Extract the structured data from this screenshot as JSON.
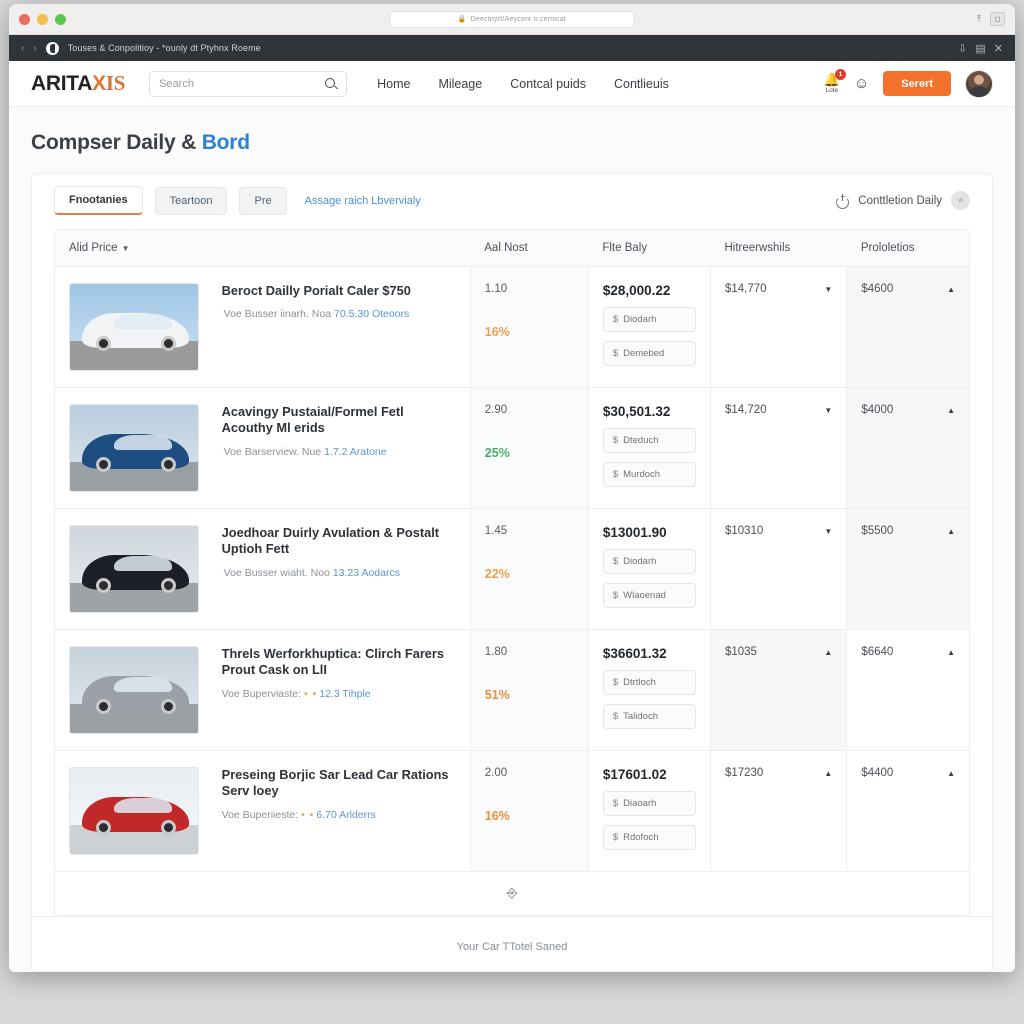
{
  "browser": {
    "url_text": "Deectnyrt/Aeyconr o.cernicat",
    "lock_icon": "lock-icon",
    "tab_title": "Touses & Conpolitioy - *ounly dt Ptyhnx Roeme",
    "back_icon": "back-arrow-icon",
    "forward_icon": "forward-arrow-icon",
    "right_icons": [
      "download-icon",
      "sidebar-icon",
      "close-icon"
    ],
    "chrome_right_icons": [
      "share-icon",
      "tabs-icon"
    ]
  },
  "header": {
    "logo": {
      "part1": "ARITA",
      "part2": "X",
      "part3": "IS"
    },
    "search": {
      "value": "",
      "placeholder": "Search"
    },
    "nav": [
      {
        "label": "Home"
      },
      {
        "label": "Mileage"
      },
      {
        "label": "Contcal puids"
      },
      {
        "label": "Contlieuis"
      }
    ],
    "bell": {
      "label": "Lote",
      "badge": "1"
    },
    "cta_label": "Serert",
    "accent_color": "#f2722b"
  },
  "page": {
    "title_main": "Compser Daily & ",
    "title_accent": "Bord",
    "accent_color": "#2f7fd4"
  },
  "tabs": {
    "items": [
      {
        "label": "Fnootanies",
        "active": true
      },
      {
        "label": "Teartoon",
        "active": false
      },
      {
        "label": "Pre",
        "active": false
      }
    ],
    "link_label": "Assage raich Lbvervialy",
    "toggle_label": "Conttletion Daily",
    "toggle_badge": "w"
  },
  "table": {
    "columns": [
      {
        "key": "image",
        "label": ""
      },
      {
        "key": "name",
        "label": "Alid Price",
        "sort": "▼"
      },
      {
        "key": "cost",
        "label": "Aal Nost"
      },
      {
        "key": "body",
        "label": "Flte Baly"
      },
      {
        "key": "hire",
        "label": "Hitreerwshils"
      },
      {
        "key": "prob",
        "label": "Prololetios"
      }
    ],
    "rows": [
      {
        "thumb": {
          "sky": "#9ec5e6",
          "ground": "#8f9694",
          "body": "#f2f3f5",
          "alt": "white-hatchback-car-photo"
        },
        "name": "Beroct Dailly Porialt Caler $750",
        "sub_prefix": "Voe Busser iinarh. Noa",
        "sub_link": "70.5.30 Oteoors",
        "stars": "",
        "cost_value": "1.10",
        "cost_pct": "16%",
        "cost_pct_color": "#e8a050",
        "price": "$28,000.22",
        "buttons": [
          "Diodarh",
          "Demebed"
        ],
        "hire_value": "$14,770",
        "hire_chevron": "▼",
        "hire_shaded": false,
        "prob_value": "$4600",
        "prob_chevron": "▲",
        "prob_shaded": true
      },
      {
        "thumb": {
          "sky": "#b9cede",
          "ground": "#9a9fa2",
          "body": "#1e4d82",
          "alt": "blue-hatchback-car-photo"
        },
        "name": "Acavingy Pustaial/Formel Fetl Acouthy Ml erids",
        "sub_prefix": "Voe Barserview. Nue",
        "sub_link": "1.7.2 Aratone",
        "stars": "",
        "cost_value": "2.90",
        "cost_pct": "25%",
        "cost_pct_color": "#4cad6a",
        "price": "$30,501.32",
        "buttons": [
          "Dteduch",
          "Murdoch"
        ],
        "hire_value": "$14,720",
        "hire_chevron": "▼",
        "hire_shaded": false,
        "prob_value": "$4000",
        "prob_chevron": "▲",
        "prob_shaded": true
      },
      {
        "thumb": {
          "sky": "#cfd6dc",
          "ground": "#9fa3a6",
          "body": "#1c1f26",
          "alt": "black-suv-car-photo"
        },
        "name": "Joedhoar Duirly Avulation & Postalt Uptioh Fett",
        "sub_prefix": "Voe Busser wiaht. Noo",
        "sub_link": "13.23 Aodarcs",
        "stars": "",
        "cost_value": "1.45",
        "cost_pct": "22%",
        "cost_pct_color": "#e8a050",
        "price": "$13001.90",
        "buttons": [
          "Diodarh",
          "Wlaoenad"
        ],
        "hire_value": "$10310",
        "hire_chevron": "▼",
        "hire_shaded": false,
        "prob_value": "$5500",
        "prob_chevron": "▲",
        "prob_shaded": true
      },
      {
        "thumb": {
          "sky": "#c6d2dc",
          "ground": "#9ca0a3",
          "body": "#9aa0a6",
          "alt": "silver-sedan-car-photo"
        },
        "name": "Threls Werforkhuptica: Clirch Farers Prout Cask on LlI",
        "sub_prefix": "Voe Buperviaste:",
        "sub_link": "12.3 Tihple",
        "stars": "• •",
        "cost_value": "1.80",
        "cost_pct": "51%",
        "cost_pct_color": "#e8903c",
        "price": "$36601.32",
        "buttons": [
          "Dtrtloch",
          "Talidoch"
        ],
        "hire_value": "$1035",
        "hire_chevron": "▲",
        "hire_shaded": true,
        "prob_value": "$6640",
        "prob_chevron": "▲",
        "prob_shaded": false
      },
      {
        "thumb": {
          "sky": "#e4e8ec",
          "ground": "#c8ccd0",
          "body": "#c0282a",
          "alt": "red-sedan-car-photo"
        },
        "name": "Preseing Borjic Sar Lead Car Rations Serv loey",
        "sub_prefix": "Voe Buperiieste:",
        "sub_link": "6.70 Arlderrs",
        "stars": "• •",
        "cost_value": "2.00",
        "cost_pct": "16%",
        "cost_pct_color": "#e8903c",
        "price": "$17601.02",
        "buttons": [
          "Diaoarh",
          "Rdofoch"
        ],
        "hire_value": "$17230",
        "hire_chevron": "▲",
        "hire_shaded": false,
        "prob_value": "$4400",
        "prob_chevron": "▲",
        "prob_shaded": false
      }
    ],
    "load_more_icon": "cursor-pointer-icon"
  },
  "footer": {
    "text": "Your Car TTotel Saned"
  }
}
